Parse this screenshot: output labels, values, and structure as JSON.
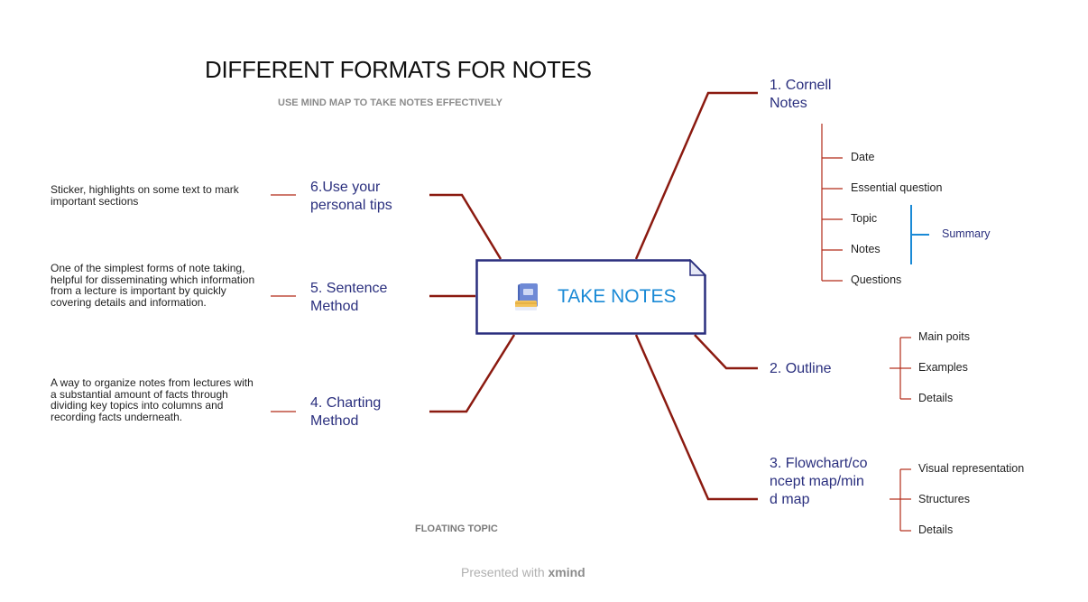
{
  "title": "DIFFERENT FORMATS FOR NOTES",
  "subtitle": "USE MIND MAP TO TAKE NOTES EFFECTIVELY",
  "center": {
    "label": "TAKE NOTES",
    "icon": "book-icon"
  },
  "right_branches": [
    {
      "label": "1. Cornell Notes",
      "children": [
        "Date",
        "Essential question",
        "Topic",
        "Notes",
        "Questions"
      ],
      "summary": "Summary"
    },
    {
      "label": "2. Outline",
      "children": [
        "Main poits",
        "Examples",
        "Details"
      ]
    },
    {
      "label": "3. Flowchart/concept map/mind map",
      "children": [
        "Visual representation",
        "Structures",
        "Details"
      ]
    }
  ],
  "left_branches": [
    {
      "label": "6.Use your personal tips",
      "note": "Sticker, highlights on some text to mark important sections"
    },
    {
      "label": "5. Sentence Method",
      "note": "One of the simplest forms of note taking, helpful for disseminating which information from a lecture is important by quickly covering details and information."
    },
    {
      "label": "4. Charting Method",
      "note": "A way to organize notes from lectures with a substantial amount of facts through dividing key topics into columns and recording facts underneath."
    }
  ],
  "floating_topic": "FLOATING TOPIC",
  "footer": {
    "prefix": "Presented with",
    "brand": "xmind"
  },
  "colors": {
    "branch_line": "#8b1a10",
    "branch_text": "#2a2f7e",
    "center_text": "#1a8ad6",
    "summary_bracket": "#1a8ad6",
    "sub_line": "#b22a18"
  }
}
